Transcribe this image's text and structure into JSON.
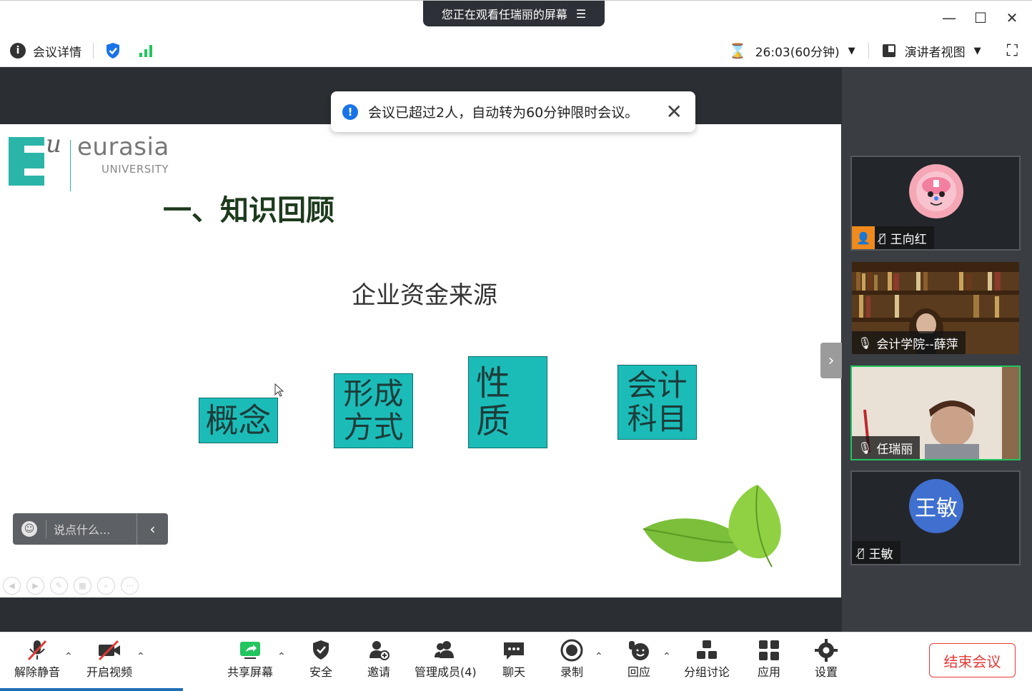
{
  "titlebar": {
    "sharing_banner": "您正在观看任瑞丽的屏幕",
    "menu_icon": "menu-lines-icon",
    "minimize": "—",
    "maximize": "☐",
    "close": "✕"
  },
  "infobar": {
    "meeting_details": "会议详情",
    "timer": "26:03(60分钟)",
    "view_mode": "演讲者视图"
  },
  "toast": {
    "message": "会议已超过2人，自动转为60分钟限时会议。"
  },
  "slide": {
    "logo_letter": "E",
    "logo_u": "u",
    "logo_name": "eurasia",
    "logo_university": "UNIVERSITY",
    "title": "一、知识回顾",
    "subtitle": "企业资金来源",
    "boxes": [
      {
        "label": "概念"
      },
      {
        "label_line1": "形成",
        "label_line2": "方式"
      },
      {
        "label_line1": "性",
        "label_line2": "质"
      },
      {
        "label_line1": "会计",
        "label_line2": "科目"
      }
    ],
    "accent_color": "#1bbcb8"
  },
  "comment_box": {
    "placeholder": "说点什么..."
  },
  "participants": [
    {
      "name": "王向红",
      "avatar": "cartoon-avatar",
      "muted": true
    },
    {
      "name": "会计学院--薛萍",
      "avatar": "video-feed",
      "muted": false
    },
    {
      "name": "任瑞丽",
      "avatar": "video-feed",
      "muted": false,
      "active": true
    },
    {
      "name": "王敏",
      "avatar_text": "王敏",
      "muted": true
    }
  ],
  "toolbar": {
    "unmute": "解除静音",
    "start_video": "开启视频",
    "share_screen": "共享屏幕",
    "security": "安全",
    "invite": "邀请",
    "members": "管理成员(4)",
    "chat": "聊天",
    "record": "录制",
    "react": "回应",
    "breakout": "分组讨论",
    "apps": "应用",
    "settings": "设置",
    "end_meeting": "结束会议"
  }
}
